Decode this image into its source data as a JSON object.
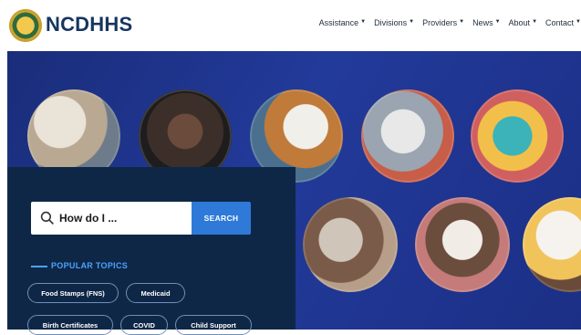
{
  "brand": {
    "name": "NCDHHS"
  },
  "nav": [
    {
      "label": "Assistance"
    },
    {
      "label": "Divisions"
    },
    {
      "label": "Providers"
    },
    {
      "label": "News"
    },
    {
      "label": "About"
    },
    {
      "label": "Contact"
    }
  ],
  "search": {
    "placeholder": "How do I ...",
    "button": "SEARCH"
  },
  "topics": {
    "title": "POPULAR TOPICS",
    "chips": [
      "Food Stamps (FNS)",
      "Medicaid",
      "Birth Certificates",
      "COVID",
      "Child Support"
    ]
  },
  "colors": {
    "brand": "#15365f",
    "hero_blue": "#223a9a",
    "panel": "#0f2747",
    "accent": "#2f7ad8",
    "topics": "#4aa3ff"
  }
}
